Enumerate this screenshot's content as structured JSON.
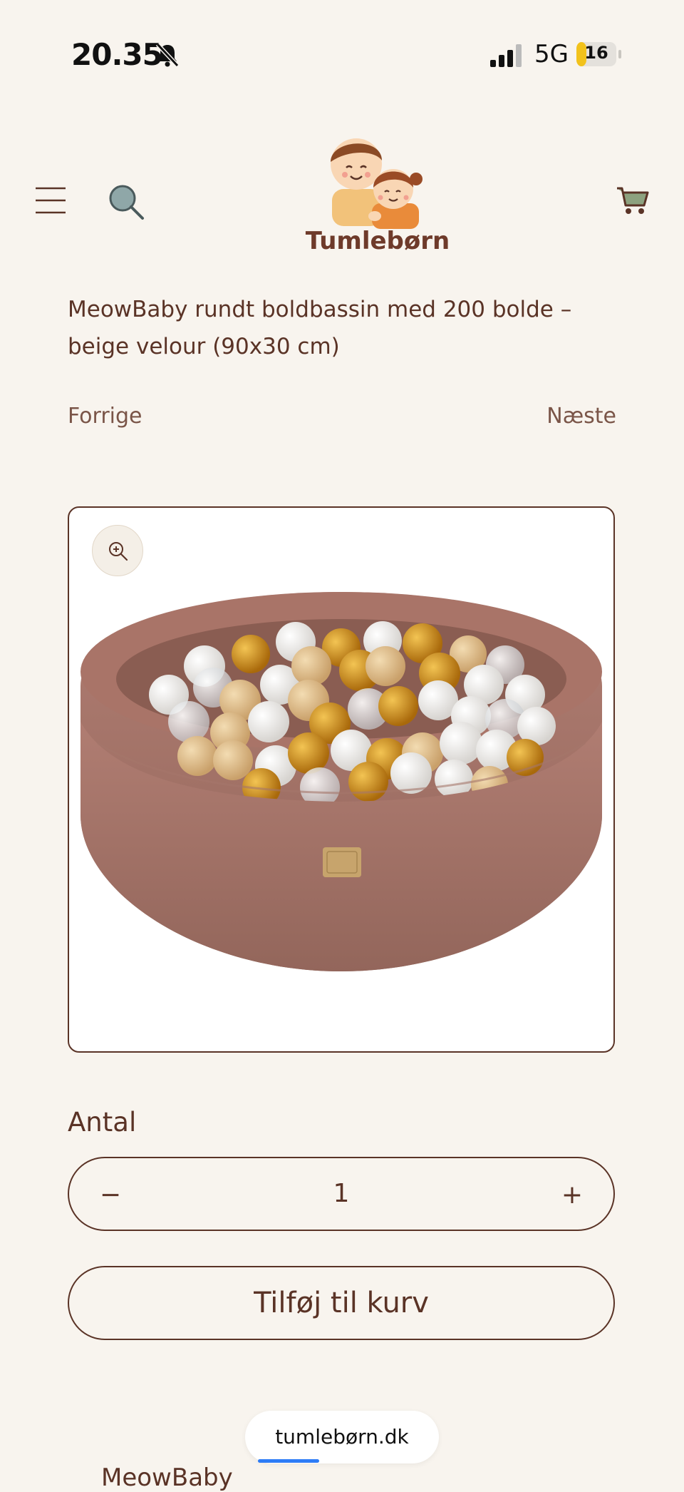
{
  "status_bar": {
    "time": "20.35",
    "network": "5G",
    "battery": "16"
  },
  "header": {
    "brand": "Tumlebørn",
    "icons": [
      "menu-icon",
      "search-icon",
      "logo-icon",
      "cart-icon"
    ]
  },
  "product": {
    "title": "MeowBaby rundt boldbassin med 200 bolde – beige velour (90x30 cm)",
    "prev_label": "Forrige",
    "next_label": "Næste"
  },
  "quantity": {
    "label": "Antal",
    "minus": "−",
    "value": "1",
    "plus": "+"
  },
  "add_to_cart_label": "Tilføj til kurv",
  "browser": {
    "url": "tumlebørn.dk"
  },
  "next_section_title": "MeowBaby",
  "colors": {
    "background": "#f8f4ee",
    "text": "#5a3326",
    "pool": "#a47367",
    "gold": "#c58a1a"
  }
}
